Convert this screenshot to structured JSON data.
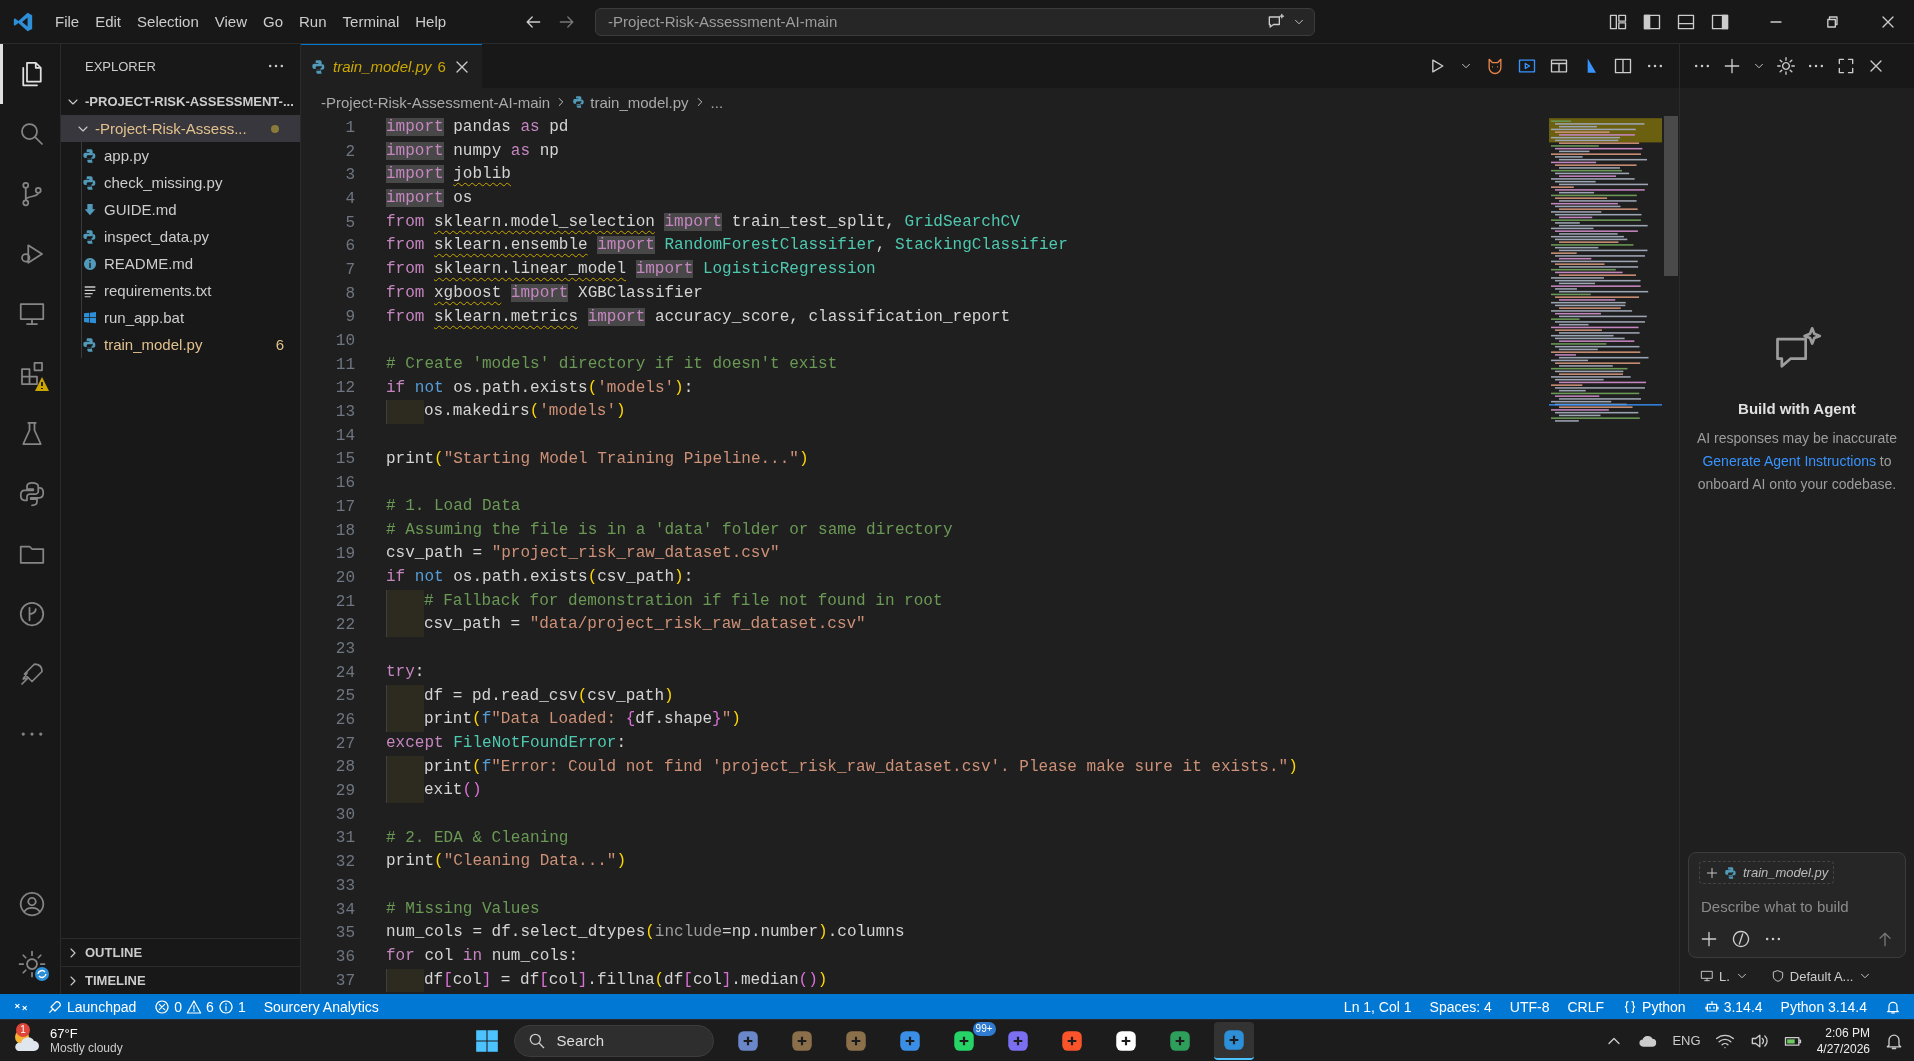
{
  "title_bar": {
    "menu": [
      "File",
      "Edit",
      "Selection",
      "View",
      "Go",
      "Run",
      "Terminal",
      "Help"
    ],
    "command_center": "-Project-Risk-Assessment-AI-main"
  },
  "activity_bar": {
    "items": [
      {
        "selected": true
      },
      {
        "selected": false
      },
      {
        "selected": false
      },
      {
        "selected": false
      },
      {
        "selected": false
      },
      {
        "selected": false
      },
      {
        "selected": false
      },
      {
        "selected": false
      },
      {
        "selected": false
      },
      {
        "selected": false
      },
      {
        "selected": false
      },
      {
        "selected": false
      }
    ]
  },
  "explorer": {
    "title": "EXPLORER",
    "root": {
      "label": "-PROJECT-RISK-ASSESSMENT-...",
      "expanded": true
    },
    "folder": {
      "label": "-Project-Risk-Assess...",
      "expanded": true,
      "selected": true,
      "modified": true
    },
    "files": [
      {
        "name": "app.py",
        "kind": "python",
        "modified": false
      },
      {
        "name": "check_missing.py",
        "kind": "python",
        "modified": false
      },
      {
        "name": "GUIDE.md",
        "kind": "download",
        "modified": false
      },
      {
        "name": "inspect_data.py",
        "kind": "python",
        "modified": false
      },
      {
        "name": "README.md",
        "kind": "info",
        "modified": false
      },
      {
        "name": "requirements.txt",
        "kind": "lines",
        "modified": false
      },
      {
        "name": "run_app.bat",
        "kind": "windows",
        "modified": false
      },
      {
        "name": "train_model.py",
        "kind": "python",
        "modified": true,
        "problems": "6"
      }
    ],
    "sections": [
      {
        "label": "OUTLINE",
        "expanded": false
      },
      {
        "label": "TIMELINE",
        "expanded": false
      }
    ]
  },
  "editor": {
    "tabs": [
      {
        "label": "train_model.py",
        "problems": "6",
        "selected": true,
        "modified": true
      }
    ],
    "breadcrumb": [
      "-Project-Risk-Assessment-AI-main",
      "train_model.py",
      "..."
    ],
    "lines": [
      {
        "number": "1",
        "indented": false,
        "tokens": [
          {
            "kind": "hl",
            "text": "import"
          },
          {
            "kind": "p",
            "text": " pandas "
          },
          {
            "kind": "kw",
            "text": "as"
          },
          {
            "kind": "p",
            "text": " pd"
          }
        ]
      },
      {
        "number": "2",
        "indented": false,
        "tokens": [
          {
            "kind": "hl",
            "text": "import"
          },
          {
            "kind": "p",
            "text": " numpy "
          },
          {
            "kind": "kw",
            "text": "as"
          },
          {
            "kind": "p",
            "text": " np"
          }
        ]
      },
      {
        "number": "3",
        "indented": false,
        "tokens": [
          {
            "kind": "hl",
            "text": "import"
          },
          {
            "kind": "mod",
            "text": " joblib"
          }
        ]
      },
      {
        "number": "4",
        "indented": false,
        "tokens": [
          {
            "kind": "hl",
            "text": "import"
          },
          {
            "kind": "p",
            "text": " os"
          }
        ]
      },
      {
        "number": "5",
        "indented": false,
        "tokens": [
          {
            "kind": "kw",
            "text": "from "
          },
          {
            "kind": "mod",
            "text": "sklearn.model_selection "
          },
          {
            "kind": "hl",
            "text": "import"
          },
          {
            "kind": "p",
            "text": " train_test_split, "
          },
          {
            "kind": "cls",
            "text": "GridSearchCV"
          }
        ]
      },
      {
        "number": "6",
        "indented": false,
        "tokens": [
          {
            "kind": "kw",
            "text": "from "
          },
          {
            "kind": "mod",
            "text": "sklearn.ensemble "
          },
          {
            "kind": "hl",
            "text": "import"
          },
          {
            "kind": "cls",
            "text": " RandomForestClassifier"
          },
          {
            "kind": "p",
            "text": ", "
          },
          {
            "kind": "cls",
            "text": "StackingClassifier"
          }
        ]
      },
      {
        "number": "7",
        "indented": false,
        "tokens": [
          {
            "kind": "kw",
            "text": "from "
          },
          {
            "kind": "mod",
            "text": "sklearn.linear_model "
          },
          {
            "kind": "hl",
            "text": "import"
          },
          {
            "kind": "cls",
            "text": " LogisticRegression"
          }
        ]
      },
      {
        "number": "8",
        "indented": false,
        "tokens": [
          {
            "kind": "kw",
            "text": "from "
          },
          {
            "kind": "mod",
            "text": "xgboost "
          },
          {
            "kind": "hl",
            "text": "import"
          },
          {
            "kind": "p",
            "text": " XGBClassifier"
          }
        ]
      },
      {
        "number": "9",
        "indented": false,
        "tokens": [
          {
            "kind": "kw",
            "text": "from "
          },
          {
            "kind": "mod",
            "text": "sklearn.metrics "
          },
          {
            "kind": "hl",
            "text": "import"
          },
          {
            "kind": "p",
            "text": " accuracy_score, classification_report"
          }
        ]
      },
      {
        "number": "10"
      },
      {
        "number": "11",
        "indented": false,
        "tokens": [
          {
            "kind": "cm",
            "text": "# Create 'models' directory if it doesn't exist"
          }
        ]
      },
      {
        "number": "12",
        "indented": false,
        "tokens": [
          {
            "kind": "kw",
            "text": "if "
          },
          {
            "kind": "op",
            "text": "not"
          },
          {
            "kind": "p",
            "text": " os.path.exists"
          },
          {
            "kind": "br",
            "text": "("
          },
          {
            "kind": "str",
            "text": "'models'"
          },
          {
            "kind": "br",
            "text": ")"
          },
          {
            "kind": "p",
            "text": ":"
          }
        ]
      },
      {
        "number": "13",
        "indented": true,
        "tokens": [
          {
            "kind": "p",
            "text": "os.makedirs"
          },
          {
            "kind": "br",
            "text": "("
          },
          {
            "kind": "str",
            "text": "'models'"
          },
          {
            "kind": "br",
            "text": ")"
          }
        ]
      },
      {
        "number": "14"
      },
      {
        "number": "15",
        "indented": false,
        "tokens": [
          {
            "kind": "p",
            "text": "print"
          },
          {
            "kind": "br",
            "text": "("
          },
          {
            "kind": "str",
            "text": "\"Starting Model Training Pipeline...\""
          },
          {
            "kind": "br",
            "text": ")"
          }
        ]
      },
      {
        "number": "16"
      },
      {
        "number": "17",
        "indented": false,
        "tokens": [
          {
            "kind": "cm",
            "text": "# 1. Load Data"
          }
        ]
      },
      {
        "number": "18",
        "indented": false,
        "tokens": [
          {
            "kind": "cm",
            "text": "# Assuming the file is in a 'data' folder or same directory"
          }
        ]
      },
      {
        "number": "19",
        "indented": false,
        "tokens": [
          {
            "kind": "p",
            "text": "csv_path = "
          },
          {
            "kind": "str",
            "text": "\"project_risk_raw_dataset.csv\""
          }
        ]
      },
      {
        "number": "20",
        "indented": false,
        "tokens": [
          {
            "kind": "kw",
            "text": "if "
          },
          {
            "kind": "op",
            "text": "not"
          },
          {
            "kind": "p",
            "text": " os.path.exists"
          },
          {
            "kind": "br",
            "text": "("
          },
          {
            "kind": "p",
            "text": "csv_path"
          },
          {
            "kind": "br",
            "text": ")"
          },
          {
            "kind": "p",
            "text": ":"
          }
        ]
      },
      {
        "number": "21",
        "indented": true,
        "tokens": [
          {
            "kind": "cm",
            "text": "# Fallback for demonstration if file not found in root"
          }
        ]
      },
      {
        "number": "22",
        "indented": true,
        "tokens": [
          {
            "kind": "p",
            "text": "csv_path = "
          },
          {
            "kind": "str",
            "text": "\"data/project_risk_raw_dataset.csv\""
          }
        ]
      },
      {
        "number": "23"
      },
      {
        "number": "24",
        "indented": false,
        "tokens": [
          {
            "kind": "kw",
            "text": "try"
          },
          {
            "kind": "p",
            "text": ":"
          }
        ]
      },
      {
        "number": "25",
        "indented": true,
        "tokens": [
          {
            "kind": "p",
            "text": "df = pd.read_csv"
          },
          {
            "kind": "br",
            "text": "("
          },
          {
            "kind": "p",
            "text": "csv_path"
          },
          {
            "kind": "br",
            "text": ")"
          }
        ]
      },
      {
        "number": "26",
        "indented": true,
        "tokens": [
          {
            "kind": "p",
            "text": "print"
          },
          {
            "kind": "br",
            "text": "("
          },
          {
            "kind": "op",
            "text": "f"
          },
          {
            "kind": "str",
            "text": "\"Data Loaded: "
          },
          {
            "kind": "br2",
            "text": "{"
          },
          {
            "kind": "p",
            "text": "df.shape"
          },
          {
            "kind": "br2",
            "text": "}"
          },
          {
            "kind": "str",
            "text": "\""
          },
          {
            "kind": "br",
            "text": ")"
          }
        ]
      },
      {
        "number": "27",
        "indented": false,
        "tokens": [
          {
            "kind": "kw",
            "text": "except "
          },
          {
            "kind": "cls",
            "text": "FileNotFoundError"
          },
          {
            "kind": "p",
            "text": ":"
          }
        ]
      },
      {
        "number": "28",
        "indented": true,
        "tokens": [
          {
            "kind": "p",
            "text": "print"
          },
          {
            "kind": "br",
            "text": "("
          },
          {
            "kind": "op",
            "text": "f"
          },
          {
            "kind": "str",
            "text": "\"Error: Could not find 'project_risk_raw_dataset.csv'. Please make sure it exists.\""
          },
          {
            "kind": "br",
            "text": ")"
          }
        ]
      },
      {
        "number": "29",
        "indented": true,
        "tokens": [
          {
            "kind": "p",
            "text": "exit"
          },
          {
            "kind": "br2",
            "text": "()"
          }
        ]
      },
      {
        "number": "30"
      },
      {
        "number": "31",
        "indented": false,
        "tokens": [
          {
            "kind": "cm",
            "text": "# 2. EDA & Cleaning"
          }
        ]
      },
      {
        "number": "32",
        "indented": false,
        "tokens": [
          {
            "kind": "p",
            "text": "print"
          },
          {
            "kind": "br",
            "text": "("
          },
          {
            "kind": "str",
            "text": "\"Cleaning Data...\""
          },
          {
            "kind": "br",
            "text": ")"
          }
        ]
      },
      {
        "number": "33"
      },
      {
        "number": "34",
        "indented": false,
        "tokens": [
          {
            "kind": "cm",
            "text": "# Missing Values"
          }
        ]
      },
      {
        "number": "35",
        "indented": false,
        "tokens": [
          {
            "kind": "p",
            "text": "num_cols = df.select_dtypes"
          },
          {
            "kind": "br",
            "text": "("
          },
          {
            "kind": "par",
            "text": "include"
          },
          {
            "kind": "p",
            "text": "=np.number"
          },
          {
            "kind": "br",
            "text": ")"
          },
          {
            "kind": "p",
            "text": ".columns"
          }
        ]
      },
      {
        "number": "36",
        "indented": false,
        "tokens": [
          {
            "kind": "kw",
            "text": "for "
          },
          {
            "kind": "p",
            "text": "col "
          },
          {
            "kind": "kw",
            "text": "in"
          },
          {
            "kind": "p",
            "text": " num_cols:"
          }
        ]
      },
      {
        "number": "37",
        "indented": true,
        "tokens": [
          {
            "kind": "p",
            "text": "df"
          },
          {
            "kind": "br2",
            "text": "["
          },
          {
            "kind": "p",
            "text": "col"
          },
          {
            "kind": "br2",
            "text": "]"
          },
          {
            "kind": "p",
            "text": " = df"
          },
          {
            "kind": "br2",
            "text": "["
          },
          {
            "kind": "p",
            "text": "col"
          },
          {
            "kind": "br2",
            "text": "]"
          },
          {
            "kind": "p",
            "text": ".fillna"
          },
          {
            "kind": "br",
            "text": "("
          },
          {
            "kind": "p",
            "text": "df"
          },
          {
            "kind": "br2",
            "text": "["
          },
          {
            "kind": "p",
            "text": "col"
          },
          {
            "kind": "br2",
            "text": "]"
          },
          {
            "kind": "p",
            "text": ".median"
          },
          {
            "kind": "br2",
            "text": "()"
          },
          {
            "kind": "br",
            "text": ")"
          }
        ]
      }
    ]
  },
  "chat": {
    "title": "Build with Agent",
    "notice": "AI responses may be inaccurate",
    "link": "Generate Agent Instructions",
    "after_link": " to onboard AI onto your codebase.",
    "context_file": "train_model.py",
    "placeholder": "Describe what to build",
    "target": "L.",
    "agent": "Default A..."
  },
  "status_bar": {
    "left": [
      {
        "kind": "remote"
      },
      {
        "kind": "launchpad",
        "text": "Launchpad"
      },
      {
        "kind": "problems",
        "errors": "0",
        "warnings": "6",
        "infos": "1"
      },
      {
        "kind": "text",
        "text": "Sourcery Analytics"
      }
    ],
    "right": [
      {
        "kind": "text",
        "text": "Ln 1, Col 1"
      },
      {
        "kind": "text",
        "text": "Spaces: 4"
      },
      {
        "kind": "text",
        "text": "UTF-8"
      },
      {
        "kind": "text",
        "text": "CRLF"
      },
      {
        "kind": "language",
        "text": "Python"
      },
      {
        "kind": "robot",
        "text": "3.14.4"
      },
      {
        "kind": "text",
        "text": "Python 3.14.4"
      },
      {
        "kind": "bell"
      }
    ]
  },
  "taskbar": {
    "weather": {
      "badge": "1",
      "temperature": "67°F",
      "condition": "Mostly cloudy"
    },
    "search": "Search",
    "apps": [
      {
        "kind": "globe",
        "selected": false
      },
      {
        "kind": "tile",
        "selected": false
      },
      {
        "kind": "tile",
        "selected": false
      },
      {
        "kind": "store",
        "selected": false
      },
      {
        "kind": "chat",
        "badge": "99+",
        "selected": false
      },
      {
        "kind": "copilot",
        "selected": false
      },
      {
        "kind": "browser",
        "selected": false
      },
      {
        "kind": "notes",
        "selected": false
      },
      {
        "kind": "download",
        "selected": false
      },
      {
        "kind": "editor",
        "selected": true
      }
    ],
    "language": "ENG",
    "time": "2:06 PM",
    "date": "4/27/2026"
  }
}
